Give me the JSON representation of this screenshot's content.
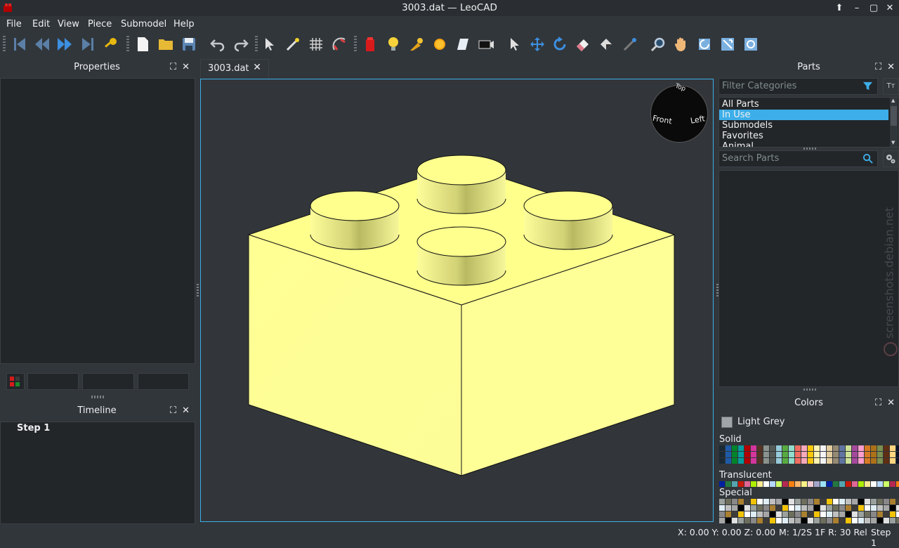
{
  "window": {
    "title": "3003.dat — LeoCAD"
  },
  "menu": {
    "file": "File",
    "edit": "Edit",
    "view": "View",
    "piece": "Piece",
    "submodel": "Submodel",
    "help": "Help"
  },
  "docks": {
    "properties": "Properties",
    "timeline": "Timeline",
    "parts": "Parts",
    "colors": "Colors"
  },
  "timeline": {
    "steps": [
      "Step 1"
    ]
  },
  "document_tab": {
    "label": "3003.dat"
  },
  "viewsphere": {
    "top": "Top",
    "front": "Front",
    "left": "Left"
  },
  "parts": {
    "filter_placeholder": "Filter Categories",
    "categories": [
      "All Parts",
      "In Use",
      "Submodels",
      "Favorites",
      "Animal"
    ],
    "selected_category": "In Use",
    "search_placeholder": "Search Parts"
  },
  "watermark": "screenshots.debian.net",
  "colors": {
    "current": "Light Grey",
    "current_hex": "#a0a5a9",
    "groups": [
      "Solid",
      "Translucent",
      "Special"
    ],
    "solid_palette": [
      "#1b2a34",
      "#1e5aa8",
      "#00852b",
      "#069d9f",
      "#b40000",
      "#d3359d",
      "#543324",
      "#8a928d",
      "#545955",
      "#97cbd9",
      "#58ab41",
      "#91dcca",
      "#f06d61",
      "#f6a9bb",
      "#fac80a",
      "#fff4b2",
      "#f4f4f4",
      "#e4cd9e",
      "#958a73",
      "#6074a1",
      "#cce197",
      "#a5499c",
      "#ff9ecd",
      "#d67923",
      "#ad7118",
      "#7c9051",
      "#5f2e13",
      "#ffd67f",
      "#0a1327",
      "#6c96bf",
      "#ffa531"
    ],
    "translucent_palette": [
      "#0020a0",
      "#237841",
      "#55a5af",
      "#c91a09",
      "#df6695",
      "#aeef00",
      "#fbe890",
      "#ffffff",
      "#b6d7ff",
      "#ccff66",
      "#b52952",
      "#ff800d",
      "#fcb76d",
      "#f8f184",
      "#f5cdd4",
      "#a5a5cb",
      "#9be2f7"
    ],
    "special_palette": [
      "#9ba19d",
      "#6d6e5c",
      "#898788",
      "#aa7f2e",
      "#3e3c39",
      "#f3c305",
      "#ffffff",
      "#dfeef5",
      "#c0c0c0",
      "#a6a6a6",
      "#000000",
      "#e0e0e0"
    ]
  },
  "status": {
    "coords": "X: 0.00 Y: 0.00 Z: 0.00",
    "snap": "M: 1/2S 1F R: 30 Rel",
    "step": "Step 1"
  },
  "model": {
    "brick_color": "#ffff80"
  }
}
